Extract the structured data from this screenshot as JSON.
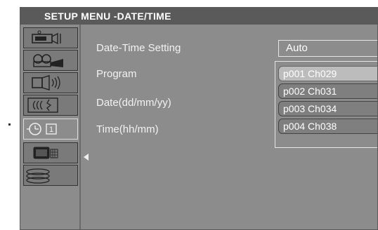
{
  "window": {
    "title": "SETUP MENU -DATE/TIME"
  },
  "sidebar": {
    "tabs": [
      {
        "icon": "video-camera-icon"
      },
      {
        "icon": "projector-icon"
      },
      {
        "icon": "speaker-icon"
      },
      {
        "icon": "signal-wave-icon"
      },
      {
        "icon": "clock-icon",
        "badge": "1",
        "active": true
      },
      {
        "icon": "display-grid-icon"
      },
      {
        "icon": "disc-stack-icon"
      }
    ]
  },
  "settings": [
    {
      "label": "Date-Time Setting"
    },
    {
      "label": "Program"
    },
    {
      "label": "Date(dd/mm/yy)"
    },
    {
      "label": "Time(hh/mm)"
    }
  ],
  "date_time_setting": {
    "value": "Auto"
  },
  "program_dropdown": {
    "options": [
      "p001 Ch029",
      "p002 Ch031",
      "p003 Ch034",
      "p004 Ch038"
    ],
    "selected_index": 0
  },
  "colors": {
    "panel": "#8c8c8c",
    "title_bar": "#5a5a5a",
    "selected_option": "#bcbcbc"
  }
}
